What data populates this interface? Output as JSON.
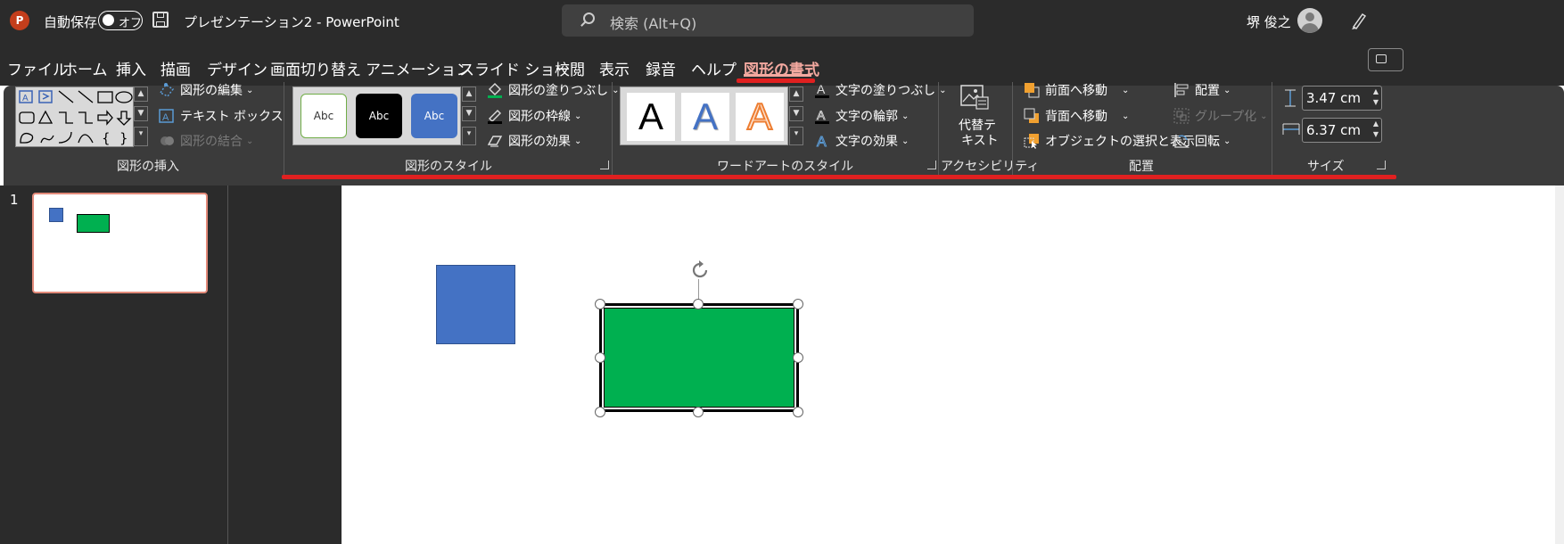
{
  "titlebar": {
    "autosave_label": "自動保存",
    "toggle_label": "オフ",
    "doc_title": "プレゼンテーション2 - PowerPoint",
    "search_placeholder": "検索 (Alt+Q)",
    "user_name": "堺 俊之"
  },
  "menu": [
    "ファイル",
    "ホーム",
    "挿入",
    "描画",
    "デザイン",
    "画面切り替え",
    "アニメーション",
    "スライド ショー",
    "校閲",
    "表示",
    "録音",
    "ヘルプ",
    "図形の書式"
  ],
  "ribbon": {
    "insert_shapes": {
      "edit_shape": "図形の編集",
      "text_box": "テキスト ボックス",
      "merge_shapes": "図形の結合",
      "group_label": "図形の挿入"
    },
    "shape_styles": {
      "samples": [
        "Abc",
        "Abc",
        "Abc"
      ],
      "fill": "図形の塗りつぶし",
      "outline": "図形の枠線",
      "effects": "図形の効果",
      "group_label": "図形のスタイル"
    },
    "wordart": {
      "samples": [
        "A",
        "A",
        "A"
      ],
      "text_fill": "文字の塗りつぶし",
      "text_outline": "文字の輪郭",
      "text_effects": "文字の効果",
      "group_label": "ワードアートのスタイル"
    },
    "accessibility": {
      "alt_text_line1": "代替テ",
      "alt_text_line2": "キスト",
      "group_label": "アクセシビリティ"
    },
    "arrange": {
      "bring_forward": "前面へ移動",
      "send_backward": "背面へ移動",
      "selection_pane": "オブジェクトの選択と表示",
      "align": "配置",
      "group": "グループ化",
      "rotate": "回転",
      "group_label": "配置"
    },
    "size": {
      "height": "3.47 cm",
      "width": "6.37 cm",
      "group_label": "サイズ"
    }
  },
  "slides": {
    "number": "1"
  },
  "colors": {
    "accent": "#e02020",
    "blue_shape": "#4472c4",
    "green_shape": "#00b050",
    "active_tab": "#f4a9a0"
  }
}
